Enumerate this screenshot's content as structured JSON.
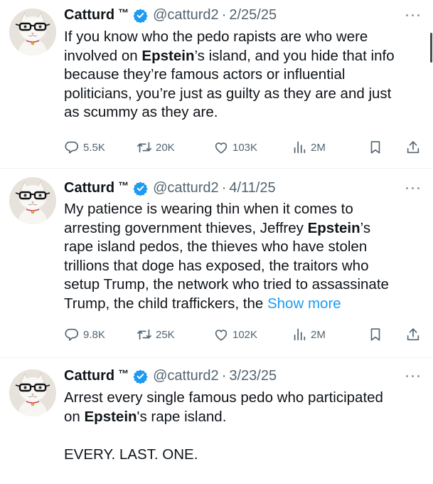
{
  "tweets": [
    {
      "name": "Catturd",
      "tm": "™",
      "handle": "@catturd2",
      "separator": "·",
      "date": "2/25/25",
      "text_lines": [
        {
          "parts": [
            {
              "t": "If you know who the pedo rapists are who were",
              "b": false
            }
          ]
        },
        {
          "parts": [
            {
              "t": "involved on ",
              "b": false
            },
            {
              "t": "Epstein",
              "b": true
            },
            {
              "t": "’s island, and you hide that info",
              "b": false
            }
          ]
        },
        {
          "parts": [
            {
              "t": "because they’re famous actors or influential",
              "b": false
            }
          ]
        },
        {
          "parts": [
            {
              "t": "politicians, you’re just as guilty as they are and just",
              "b": false
            }
          ]
        },
        {
          "parts": [
            {
              "t": "as scummy as they are.",
              "b": false
            }
          ]
        }
      ],
      "replies": "5.5K",
      "reposts": "20K",
      "likes": "103K",
      "views": "2M"
    },
    {
      "name": "Catturd",
      "tm": "™",
      "handle": "@catturd2",
      "separator": "·",
      "date": "4/11/25",
      "text_lines": [
        {
          "parts": [
            {
              "t": "My patience is wearing thin when it comes to",
              "b": false
            }
          ]
        },
        {
          "parts": [
            {
              "t": "arresting government thieves, Jeffrey ",
              "b": false
            },
            {
              "t": "Epstein",
              "b": true
            },
            {
              "t": "’s",
              "b": false
            }
          ]
        },
        {
          "parts": [
            {
              "t": "rape island pedos, the thieves who have stolen",
              "b": false
            }
          ]
        },
        {
          "parts": [
            {
              "t": "trillions that doge has exposed, the traitors who",
              "b": false
            }
          ]
        },
        {
          "parts": [
            {
              "t": "setup Trump, the network who tried to assassinate",
              "b": false
            }
          ]
        },
        {
          "parts": [
            {
              "t": "Trump, the child traffickers, the ",
              "b": false
            },
            {
              "t": "Show more",
              "b": false,
              "link": true
            }
          ]
        }
      ],
      "replies": "9.8K",
      "reposts": "25K",
      "likes": "102K",
      "views": "2M"
    },
    {
      "name": "Catturd",
      "tm": "™",
      "handle": "@catturd2",
      "separator": "·",
      "date": "3/23/25",
      "text_lines": [
        {
          "parts": [
            {
              "t": "Arrest every single famous pedo who participated",
              "b": false
            }
          ]
        },
        {
          "parts": [
            {
              "t": "on ",
              "b": false
            },
            {
              "t": "Epstein",
              "b": true
            },
            {
              "t": "'s rape island.",
              "b": false
            }
          ]
        },
        {
          "parts": [
            {
              "t": "",
              "b": false
            }
          ]
        },
        {
          "parts": [
            {
              "t": "EVERY. LAST. ONE.",
              "b": false
            }
          ]
        }
      ]
    }
  ],
  "colors": {
    "text": "#0f1419",
    "secondary": "#536471",
    "link": "#1d9bf0",
    "verified": "#1d9bf0",
    "divider": "#eff3f4"
  },
  "icons": [
    "verified-badge-icon",
    "more-options-icon",
    "reply-icon",
    "repost-icon",
    "like-icon",
    "views-icon",
    "bookmark-icon",
    "share-icon"
  ]
}
